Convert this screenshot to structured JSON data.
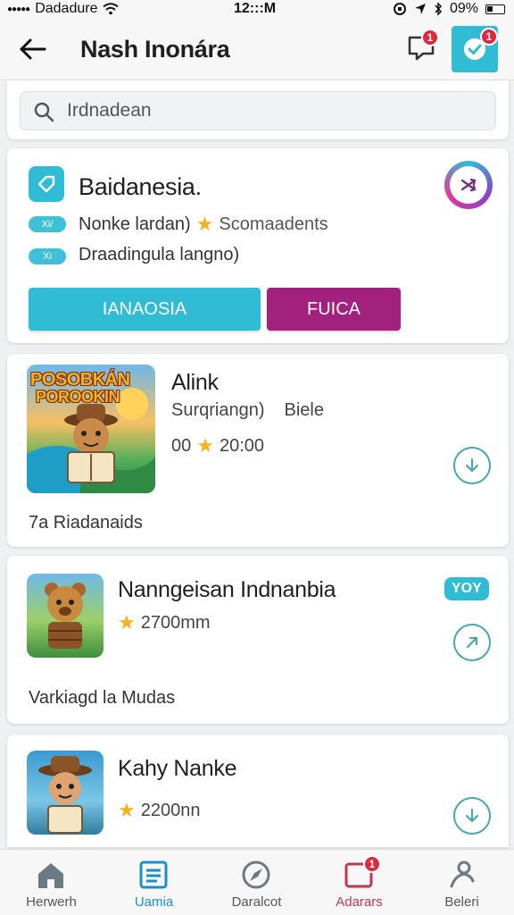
{
  "status_bar": {
    "carrier": "Dadadure",
    "time": "12:::M",
    "battery": "09%"
  },
  "header": {
    "title": "Nash Inonára",
    "chat_badge": "1",
    "check_badge": "1"
  },
  "search": {
    "value": "Irdnadean",
    "placeholder": "Irdnadean"
  },
  "promo": {
    "title": "Baidanesia.",
    "line1_pill": "Xi/",
    "line1_text": "Nonke lardan)",
    "line1_suffix": "Scomaadents",
    "line2_pill": "Xi",
    "line2_text": "Draadingula langno)",
    "button_primary": "IANAOSIA",
    "button_secondary": "FUICA",
    "colors": {
      "accent": "#2fbcd4",
      "secondary": "#a3217e"
    }
  },
  "items": [
    {
      "thumb_text_top": "POSOBKÁN",
      "thumb_text_bottom": "POROOKIN",
      "title": "Alink",
      "subtitle_a": "Surqriangn)",
      "subtitle_b": "Biele",
      "rating_prefix": "00",
      "rating_value": "20:00",
      "footer": "7a Riadanaids",
      "action_icon": "download-icon"
    },
    {
      "title": "Nanngeisan Indnanbia",
      "tag": "YOY",
      "rating_value": "2700mm",
      "footer": "Varkiagd la Mudas",
      "action_icon": "chevron-icon"
    },
    {
      "title": "Kahy Nanke",
      "rating_value": "2200nn",
      "action_icon": "download-icon"
    }
  ],
  "bottom_nav": [
    {
      "label": "Herwerh",
      "icon": "home-icon"
    },
    {
      "label": "Uamia",
      "icon": "list-icon",
      "active": true
    },
    {
      "label": "Daralcot",
      "icon": "compass-icon"
    },
    {
      "label": "Adarars",
      "icon": "inbox-icon",
      "badge": "1"
    },
    {
      "label": "Beleri",
      "icon": "profile-icon"
    }
  ]
}
